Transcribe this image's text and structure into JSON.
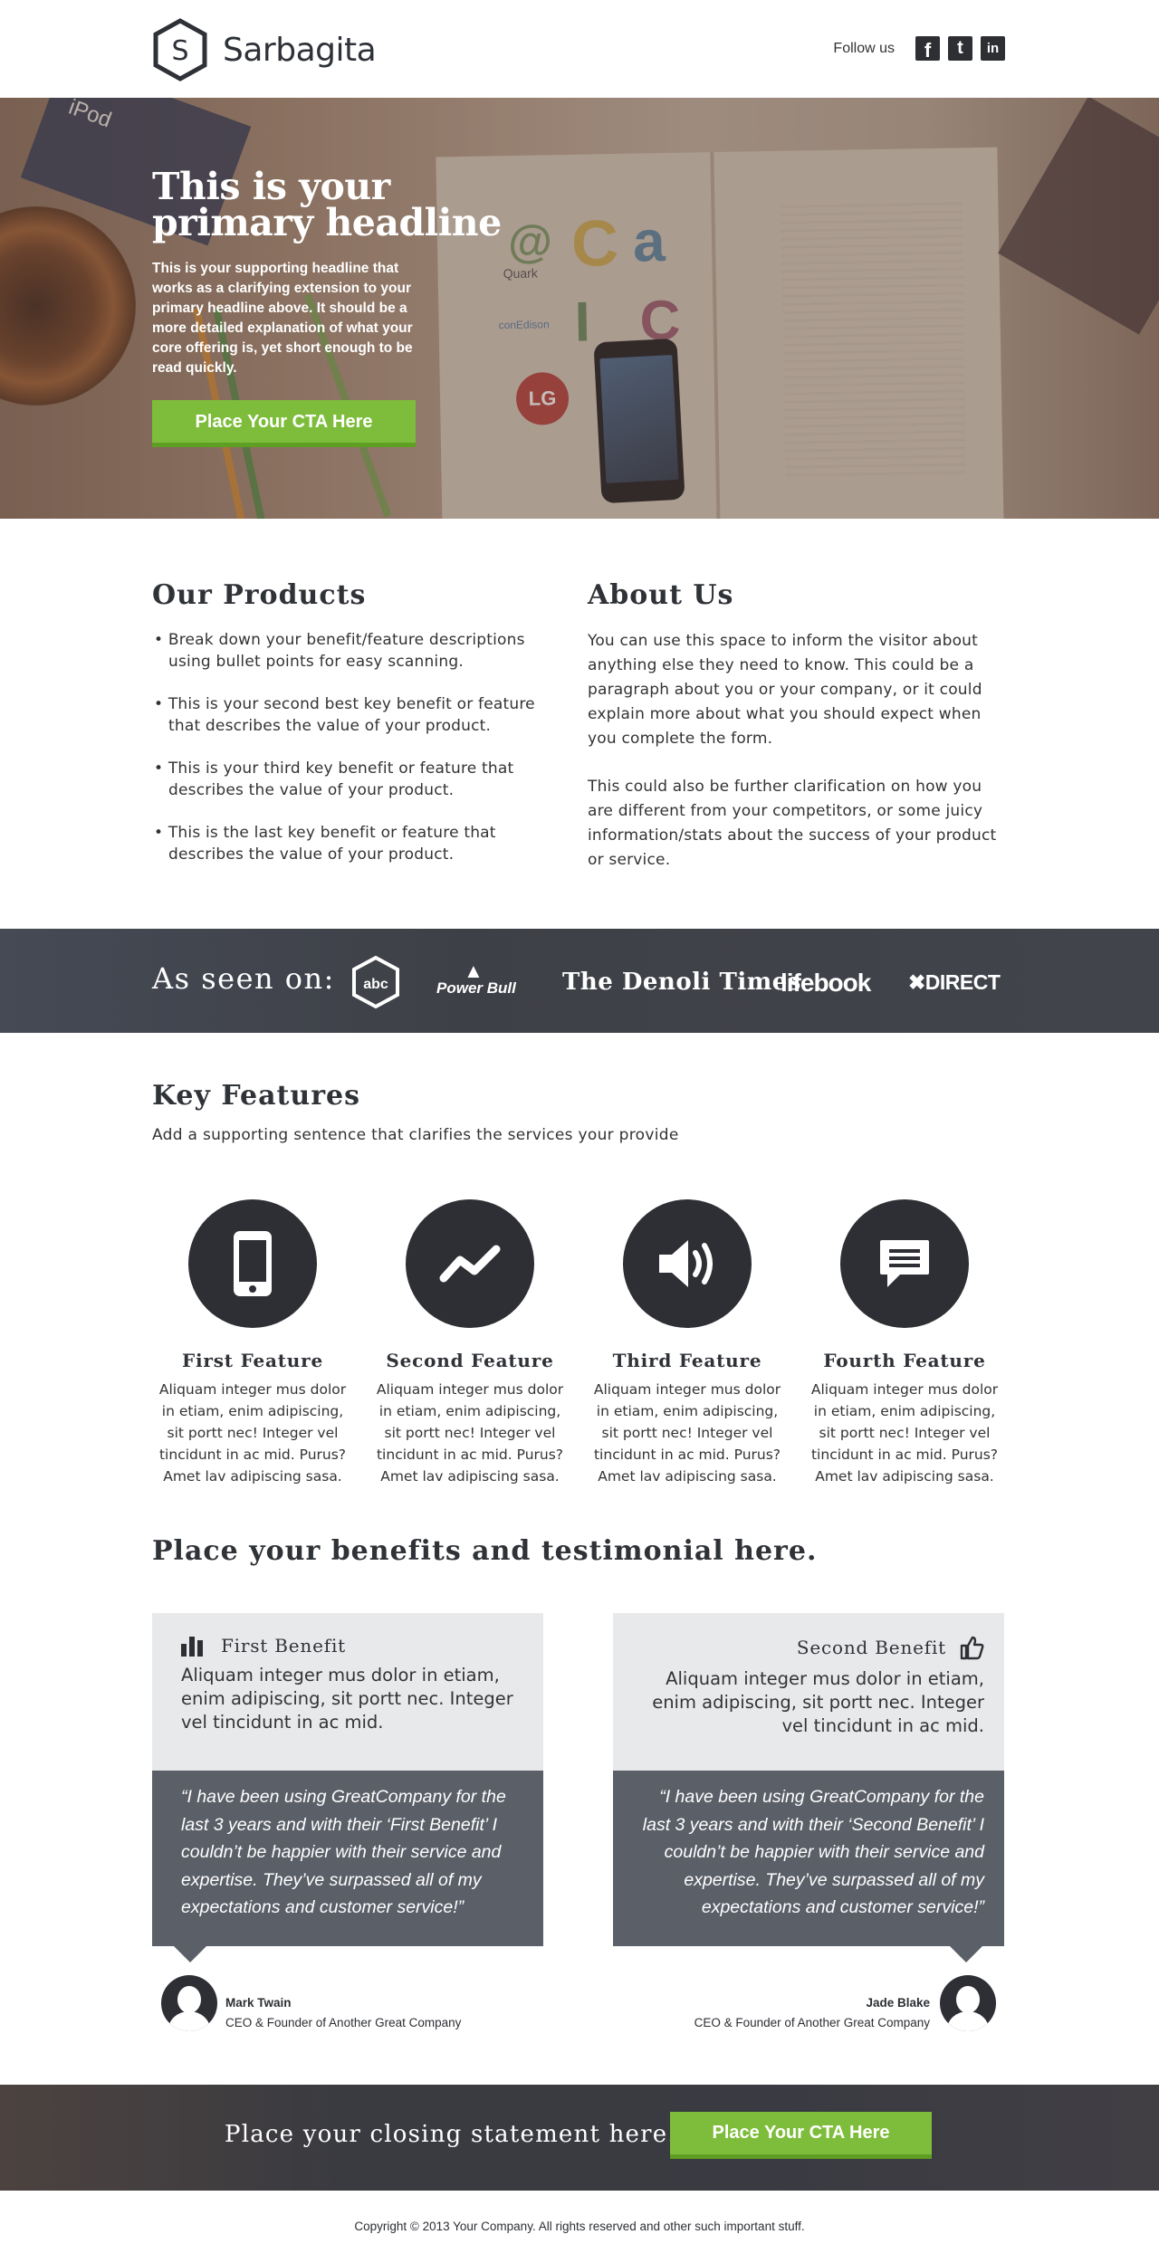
{
  "header": {
    "brand": "Sarbagita",
    "logo_letter": "S",
    "follow_label": "Follow us",
    "social": [
      {
        "icon": "facebook-icon",
        "glyph": "f"
      },
      {
        "icon": "twitter-icon",
        "glyph": "t"
      },
      {
        "icon": "linkedin-icon",
        "glyph": "in"
      }
    ]
  },
  "hero": {
    "headline": "This is your primary headline",
    "subheadline": "This is your supporting headline that works as a clarifying extension to your primary headline above. It should be a more detailed explanation of what your core offering is, yet short enough to be read quickly.",
    "cta_label": "Place Your CTA Here",
    "image_marks": {
      "quark": "Quark",
      "conedison": "conEdison",
      "lg": "LG",
      "ipod": "iPod"
    }
  },
  "products": {
    "title": "Our Products",
    "bullets": [
      "Break down your benefit/feature descriptions using bullet points for easy scanning.",
      "This is your second best key benefit or feature that describes the value of your product.",
      "This is your third key benefit or feature that describes the value of your product.",
      "This is the last key benefit or feature that describes the value of your product."
    ]
  },
  "about": {
    "title": "About Us",
    "paragraphs": [
      "You can use this space to inform the visitor about anything else they need to know. This could be a paragraph about you or your company, or it could explain more about what you should expect when you complete the form.",
      "This could also be further clarification on how you are different from your competitors, or some juicy information/stats about the success of your product or service."
    ]
  },
  "seen_on": {
    "label": "As seen on:",
    "logos": [
      "abc",
      "Power Bull",
      "The Denoli Times",
      "lifebook",
      "DIRECT"
    ]
  },
  "features": {
    "title": "Key Features",
    "subtitle": "Add a supporting sentence that clarifies the services your provide",
    "items": [
      {
        "icon": "smartphone-icon",
        "title": "First Feature",
        "text": "Aliquam integer mus dolor in etiam, enim adipiscing, sit portt nec! Integer vel tincidunt in ac mid. Purus? Amet lav adipiscing sasa."
      },
      {
        "icon": "trend-line-icon",
        "title": "Second Feature",
        "text": "Aliquam integer mus dolor in etiam, enim adipiscing, sit portt nec! Integer vel tincidunt in ac mid. Purus? Amet lav adipiscing sasa."
      },
      {
        "icon": "speaker-icon",
        "title": "Third Feature",
        "text": "Aliquam integer mus dolor in etiam, enim adipiscing, sit portt nec! Integer vel tincidunt in ac mid. Purus? Amet lav adipiscing sasa."
      },
      {
        "icon": "chat-bubble-icon",
        "title": "Fourth Feature",
        "text": "Aliquam integer mus dolor in etiam, enim adipiscing, sit portt nec! Integer vel tincidunt in ac mid. Purus? Amet lav adipiscing sasa."
      }
    ]
  },
  "benefits": {
    "title": "Place your benefits and testimonial here.",
    "cards": [
      {
        "icon": "bar-chart-icon",
        "title": "First Benefit",
        "text": "Aliquam integer mus dolor in etiam, enim adipiscing, sit portt nec. Integer vel tincidunt in ac mid.",
        "quote": "“I have been using GreatCompany for the last 3 years and with their ‘First Benefit’ I couldn’t be happier with their service and expertise. They’ve surpassed all of my expectations and customer service!”",
        "person": "Mark Twain",
        "role": "CEO & Founder of Another Great Company"
      },
      {
        "icon": "thumbs-up-icon",
        "title": "Second Benefit",
        "text": "Aliquam integer mus dolor in etiam, enim adipiscing, sit portt nec. Integer vel tincidunt in ac mid.",
        "quote": "“I have been using GreatCompany for the last 3 years and with their ‘Second Benefit’ I couldn’t be happier with their service and expertise. They’ve surpassed all of my expectations and customer service!”",
        "person": "Jade Blake",
        "role": "CEO & Founder of Another Great Company"
      }
    ]
  },
  "closing": {
    "text": "Place your closing statement here.",
    "cta_label": "Place Your CTA Here"
  },
  "footer": {
    "copyright": "Copyright © 2013 Your Company. All rights reserved and other such important stuff."
  },
  "colors": {
    "accent": "#7ebd3b",
    "dark": "#2d2f34",
    "quote_bg": "#5b5f68",
    "card_bg": "#e8e9eb"
  }
}
